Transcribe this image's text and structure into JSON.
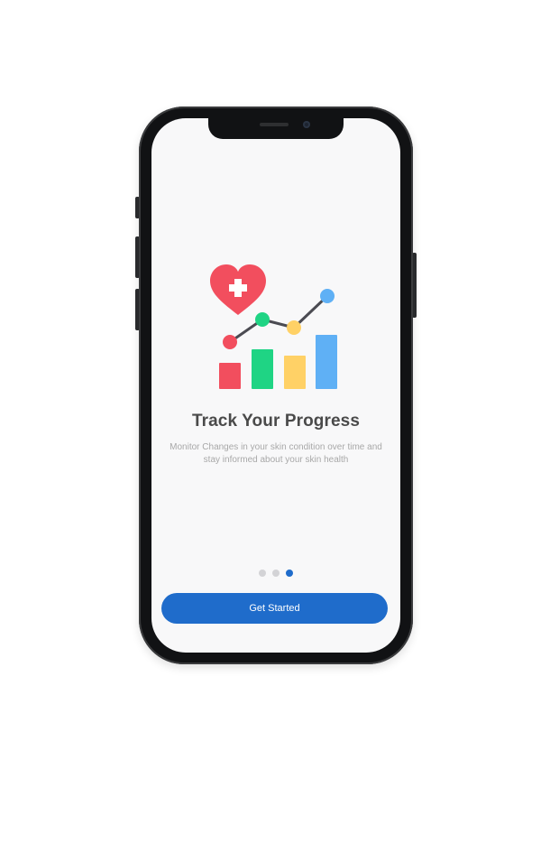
{
  "onboarding": {
    "title": "Track Your Progress",
    "subtitle": "Monitor Changes in your skin condition over time and stay informed about your skin health",
    "page_indicator": {
      "total": 3,
      "current": 3
    },
    "cta_label": "Get Started"
  },
  "colors": {
    "accent": "#1f6ccb",
    "heart": "#f24e5e",
    "bar_red": "#f24e5e",
    "bar_green": "#1fd484",
    "bar_yellow": "#ffd166",
    "bar_blue": "#5fb0f5"
  },
  "icons": [
    "heart-plus-icon",
    "progress-chart-icon"
  ]
}
